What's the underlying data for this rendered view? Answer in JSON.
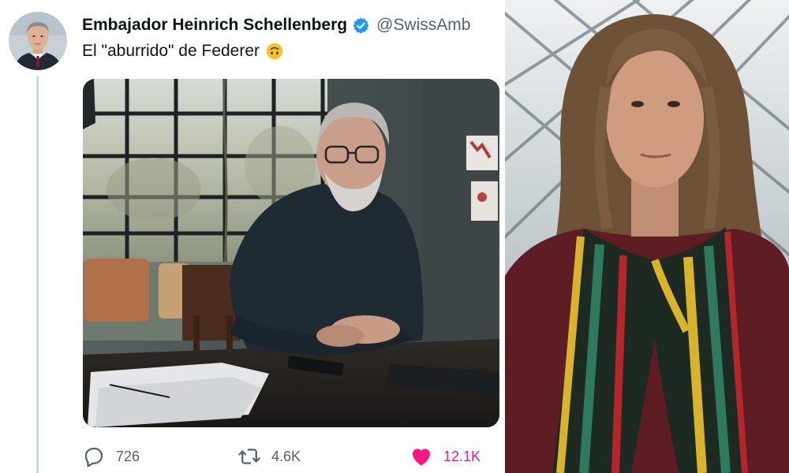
{
  "tweet": {
    "author_name": "Embajador Heinrich Schellenberg",
    "handle": "@SwissAmb",
    "text": "El \"aburrido\" de Federer",
    "emoji": "upside-down-face-emoji",
    "media_alt": "photo-older-man-seated-at-desk-by-window",
    "actions": {
      "reply_count": "726",
      "retweet_count": "4.6K",
      "like_count": "12.1K"
    },
    "colors": {
      "verified": "#1d9bf0",
      "like": "#f91880",
      "secondary_text": "#536471",
      "thread_line": "#cfd9de"
    }
  },
  "side_photo": {
    "alt": "photo-woman-with-striped-scarf-under-glass-roof"
  }
}
